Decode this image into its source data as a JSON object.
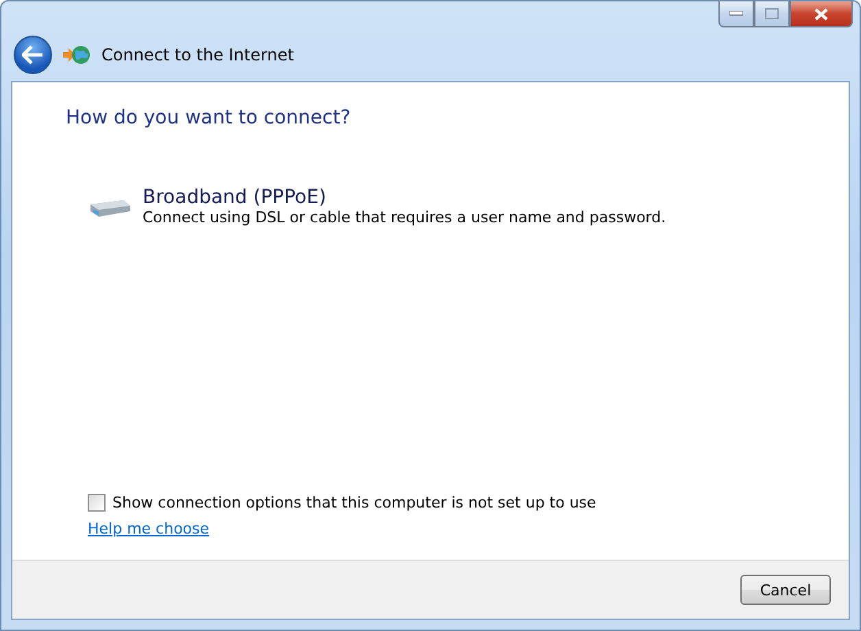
{
  "window": {
    "title": "Connect to the Internet"
  },
  "heading": "How do you want to connect?",
  "options": [
    {
      "title": "Broadband (PPPoE)",
      "description": "Connect using DSL or cable that requires a user name and password."
    }
  ],
  "show_all": {
    "label": "Show connection options that this computer is not set up to use",
    "checked": false
  },
  "help_link": "Help me choose",
  "buttons": [
    "Cancel"
  ]
}
